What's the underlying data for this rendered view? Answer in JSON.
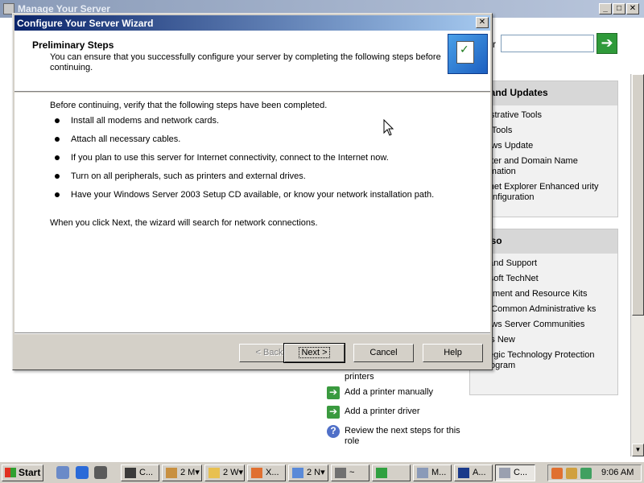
{
  "background_window": {
    "title": "Manage Your Server",
    "search_label": "r",
    "go_icon": "green-arrow-icon",
    "tools_panel": {
      "heading": "ols and Updates",
      "items": [
        "inistrative Tools",
        "re Tools",
        "dows Update",
        "puter and Domain Name ormation",
        "ernet Explorer Enhanced urity Configuration"
      ]
    },
    "see_also_panel": {
      "heading": "e Also",
      "items": [
        "p and Support",
        "rosoft TechNet",
        "loyment and Resource Kits",
        " of Common Administrative ks",
        "dows Server Communities",
        "at's New",
        "ategic Technology Protection Program"
      ]
    },
    "tasks": [
      {
        "text": "printers",
        "icon": "none"
      },
      {
        "text": "Add a printer manually",
        "icon": "green-arrow-icon"
      },
      {
        "text": "Add a printer driver",
        "icon": "green-arrow-icon"
      },
      {
        "text": "Review the next steps for this role",
        "icon": "help-icon"
      }
    ]
  },
  "wizard": {
    "title": "Configure Your Server Wizard",
    "heading": "Preliminary Steps",
    "subheading": "You can ensure that you successfully configure your server by completing the following steps before continuing.",
    "intro": "Before continuing, verify that the following steps have been completed.",
    "steps": [
      "Install all modems and network cards.",
      "Attach all necessary cables.",
      "If you plan to use this server for Internet connectivity, connect to the Internet now.",
      "Turn on all peripherals, such as printers and external drives.",
      "Have your Windows Server 2003 Setup CD available, or know your network installation path."
    ],
    "outro": "When you click Next, the wizard will search for network connections.",
    "buttons": {
      "back": "< Back",
      "next": "Next >",
      "cancel": "Cancel",
      "help": "Help"
    }
  },
  "taskbar": {
    "start_label": "Start",
    "tasks": [
      "C...",
      "2 M▾",
      "2 W▾",
      "X...",
      "2 N▾",
      "~",
      "",
      "M...",
      "A...",
      "C..."
    ],
    "clock": "9:06 AM"
  },
  "colors": {
    "title_active": "#0a246a",
    "title_inactive": "#8a9bb8",
    "face": "#d4d0c8"
  }
}
